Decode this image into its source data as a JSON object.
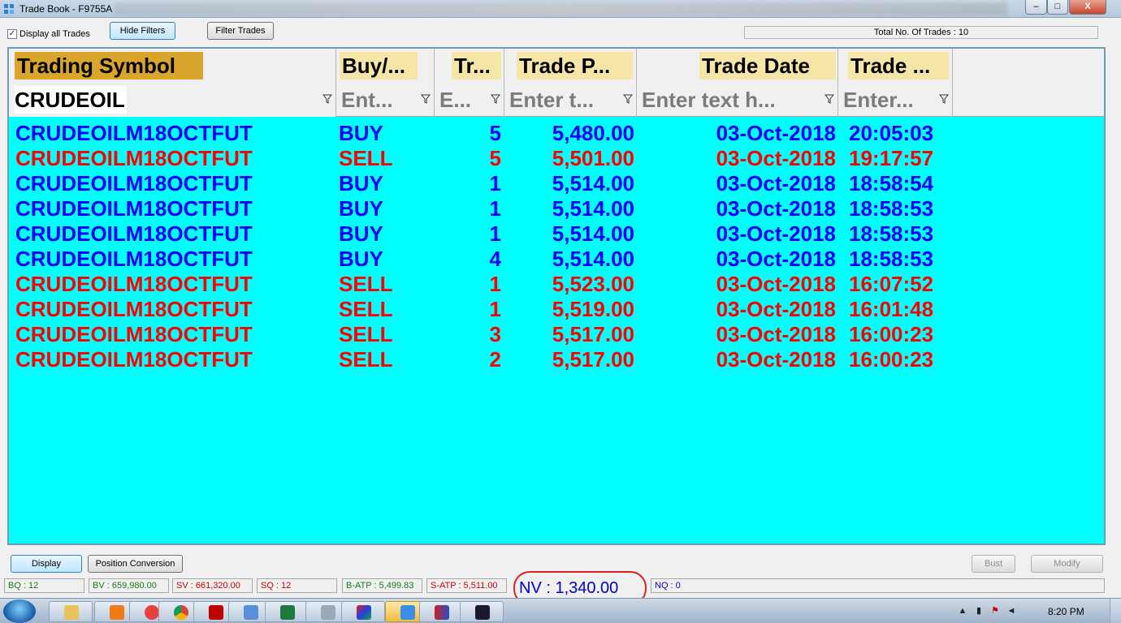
{
  "window": {
    "title": "Trade Book - F9755A",
    "minimize": "–",
    "maximize": "□",
    "close": "X"
  },
  "toolbar": {
    "display_all_label": "Display all Trades",
    "display_all_checked": true,
    "hide_filters_label": "Hide Filters",
    "filter_trades_label": "Filter Trades",
    "total_trades": "Total No. Of Trades : 10"
  },
  "grid": {
    "columns": [
      {
        "header": "Trading Symbol",
        "filter": "CRUDEOIL"
      },
      {
        "header": "Buy/...",
        "filter": "Ent..."
      },
      {
        "header": "Tr...",
        "filter": "E..."
      },
      {
        "header": "Trade P...",
        "filter": "Enter t..."
      },
      {
        "header": "Trade Date",
        "filter": "Enter text h..."
      },
      {
        "header": "Trade ...",
        "filter": "Enter..."
      }
    ],
    "rows": [
      {
        "symbol": "CRUDEOILM18OCTFUT",
        "side": "BUY",
        "qty": "5",
        "price": "5,480.00",
        "date": "03-Oct-2018",
        "time": "20:05:03"
      },
      {
        "symbol": "CRUDEOILM18OCTFUT",
        "side": "SELL",
        "qty": "5",
        "price": "5,501.00",
        "date": "03-Oct-2018",
        "time": "19:17:57"
      },
      {
        "symbol": "CRUDEOILM18OCTFUT",
        "side": "BUY",
        "qty": "1",
        "price": "5,514.00",
        "date": "03-Oct-2018",
        "time": "18:58:54"
      },
      {
        "symbol": "CRUDEOILM18OCTFUT",
        "side": "BUY",
        "qty": "1",
        "price": "5,514.00",
        "date": "03-Oct-2018",
        "time": "18:58:53"
      },
      {
        "symbol": "CRUDEOILM18OCTFUT",
        "side": "BUY",
        "qty": "1",
        "price": "5,514.00",
        "date": "03-Oct-2018",
        "time": "18:58:53"
      },
      {
        "symbol": "CRUDEOILM18OCTFUT",
        "side": "BUY",
        "qty": "4",
        "price": "5,514.00",
        "date": "03-Oct-2018",
        "time": "18:58:53"
      },
      {
        "symbol": "CRUDEOILM18OCTFUT",
        "side": "SELL",
        "qty": "1",
        "price": "5,523.00",
        "date": "03-Oct-2018",
        "time": "16:07:52"
      },
      {
        "symbol": "CRUDEOILM18OCTFUT",
        "side": "SELL",
        "qty": "1",
        "price": "5,519.00",
        "date": "03-Oct-2018",
        "time": "16:01:48"
      },
      {
        "symbol": "CRUDEOILM18OCTFUT",
        "side": "SELL",
        "qty": "3",
        "price": "5,517.00",
        "date": "03-Oct-2018",
        "time": "16:00:23"
      },
      {
        "symbol": "CRUDEOILM18OCTFUT",
        "side": "SELL",
        "qty": "2",
        "price": "5,517.00",
        "date": "03-Oct-2018",
        "time": "16:00:23"
      }
    ]
  },
  "actions": {
    "display_label": "Display",
    "position_conversion_label": "Position Conversion",
    "bust_label": "Bust",
    "modify_label": "Modify"
  },
  "status": {
    "bq": "BQ : 12",
    "bv": "BV : 659,980.00",
    "sv": "SV : 661,320.00",
    "sq": "SQ : 12",
    "b_atp": "B-ATP : 5,499.83",
    "s_atp": "S-ATP : 5,511.00",
    "nv": "NV : 1,340.00",
    "nq": "NQ : 0"
  },
  "taskbar": {
    "clock": "8:20 PM",
    "apps": [
      "explorer-folder",
      "media-player",
      "lifebuoy",
      "chrome",
      "acrobat",
      "file-manager",
      "excel",
      "calculator",
      "trading-app",
      "trade-book",
      "chart-app",
      "terminal-app"
    ]
  },
  "colors": {
    "grid_background": "#00ffff",
    "buy": "#0000ff",
    "sell": "#ff0000",
    "header_highlight": "#f5e6a8",
    "symbol_header": "#d9a52a",
    "nv_outline": "#e02020"
  }
}
